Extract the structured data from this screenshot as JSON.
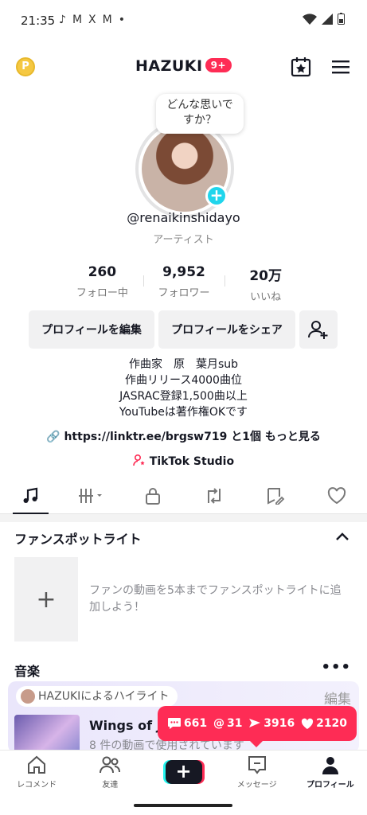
{
  "status_bar": {
    "time": "21:35",
    "notif_icons": [
      "tiktok-icon",
      "gmail-icon",
      "x-icon",
      "gmail-icon",
      "dot-icon"
    ],
    "right_icons": [
      "wifi-icon",
      "signal-icon",
      "battery-icon"
    ]
  },
  "header": {
    "coin_label": "P",
    "username": "HAZUKI",
    "badge": "9+"
  },
  "profile": {
    "bubble_line1": "どんな思いで",
    "bubble_line2": "すか？",
    "handle": "@renaikinshidayo",
    "category": "アーティスト"
  },
  "stats": [
    {
      "value": "260",
      "label": "フォロー中"
    },
    {
      "value": "9,952",
      "label": "フォロワー"
    },
    {
      "value": "20万",
      "label": "いいね"
    }
  ],
  "buttons": {
    "edit_profile": "プロフィールを編集",
    "share_profile": "プロフィールをシェア"
  },
  "bio": [
    "作曲家　原　葉月sub",
    "作曲リリース4000曲位",
    "JASRAC登録1,500曲以上",
    "YouTubeは著作権OKです"
  ],
  "link_text": "https://linktr.ee/brgsw719 と1個 もっと見る",
  "studio_text": "TikTok Studio",
  "tabs": [
    "music-note-icon",
    "playlist-icon",
    "lock-icon",
    "repost-icon",
    "tagged-icon",
    "heart-icon"
  ],
  "fan_spotlight": {
    "title": "ファンスポットライト",
    "add_symbol": "+",
    "text": "ファンの動画を5本までファンスポットライトに追加しよう！"
  },
  "music": {
    "title": "音楽",
    "more": "•••",
    "highlight_label": "HAZUKIによるハイライト",
    "edit": "編集",
    "song_title": "Wings of Ju",
    "song_sub": "8 件の動画で使用されています"
  },
  "notifications": {
    "comments": "661",
    "mentions": "31",
    "shares": "3916",
    "likes": "2120"
  },
  "bottom_nav": [
    {
      "label": "レコメンド"
    },
    {
      "label": "友達"
    },
    {
      "label": "+"
    },
    {
      "label": "メッセージ"
    },
    {
      "label": "プロフィール"
    }
  ],
  "colors": {
    "accent": "#fe2c55",
    "cyan": "#20d5ec"
  }
}
